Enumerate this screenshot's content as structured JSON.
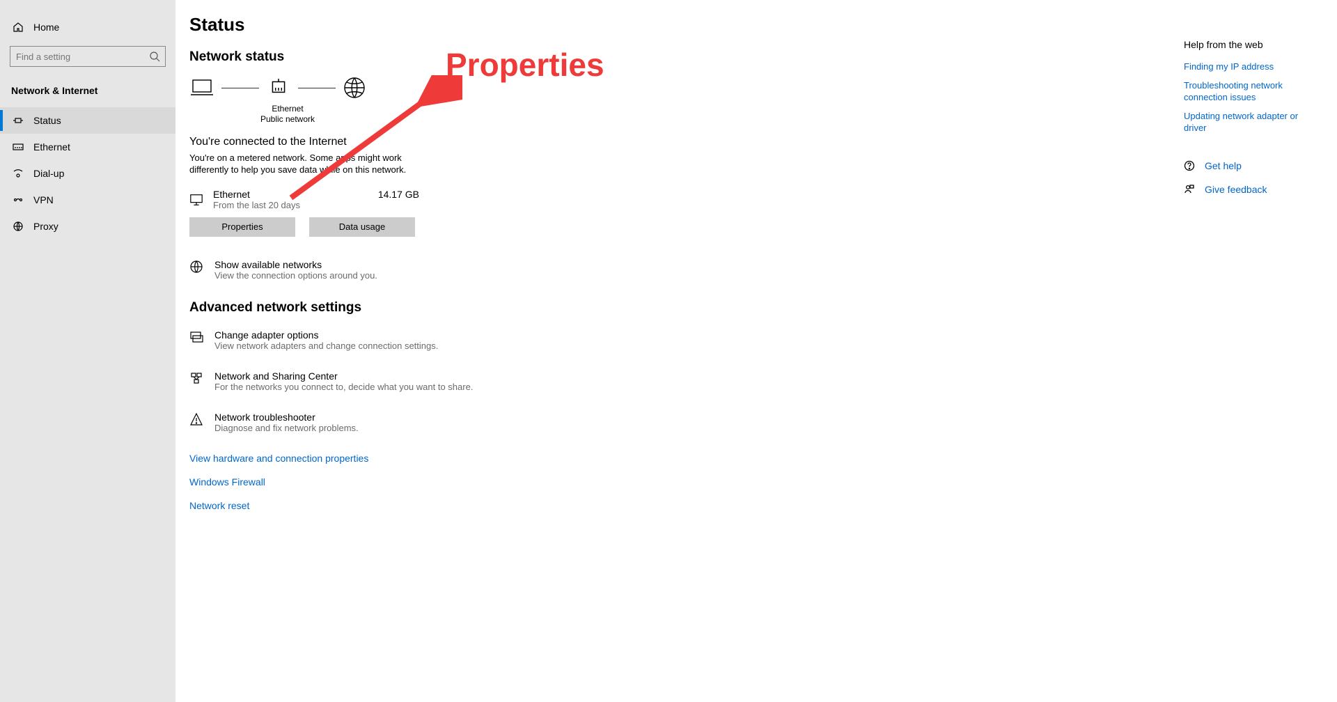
{
  "sidebar": {
    "home": "Home",
    "search_placeholder": "Find a setting",
    "section": "Network & Internet",
    "items": [
      {
        "label": "Status"
      },
      {
        "label": "Ethernet"
      },
      {
        "label": "Dial-up"
      },
      {
        "label": "VPN"
      },
      {
        "label": "Proxy"
      }
    ]
  },
  "main": {
    "title": "Status",
    "network_status_heading": "Network status",
    "diagram": {
      "adapter_name": "Ethernet",
      "network_type": "Public network"
    },
    "connected_title": "You're connected to the Internet",
    "connected_desc": "You're on a metered network. Some apps might work differently to help you save data while on this network.",
    "connection": {
      "name": "Ethernet",
      "sub": "From the last 20 days",
      "usage": "14.17 GB"
    },
    "buttons": {
      "properties": "Properties",
      "data_usage": "Data usage"
    },
    "show_networks": {
      "title": "Show available networks",
      "desc": "View the connection options around you."
    },
    "advanced_heading": "Advanced network settings",
    "adv_items": [
      {
        "title": "Change adapter options",
        "desc": "View network adapters and change connection settings."
      },
      {
        "title": "Network and Sharing Center",
        "desc": "For the networks you connect to, decide what you want to share."
      },
      {
        "title": "Network troubleshooter",
        "desc": "Diagnose and fix network problems."
      }
    ],
    "links": {
      "hw": "View hardware and connection properties",
      "firewall": "Windows Firewall",
      "reset": "Network reset"
    }
  },
  "right": {
    "heading": "Help from the web",
    "links": [
      "Finding my IP address",
      "Troubleshooting network connection issues",
      "Updating network adapter or driver"
    ],
    "get_help": "Get help",
    "give_feedback": "Give feedback"
  },
  "annotation": {
    "text": "Properties"
  }
}
